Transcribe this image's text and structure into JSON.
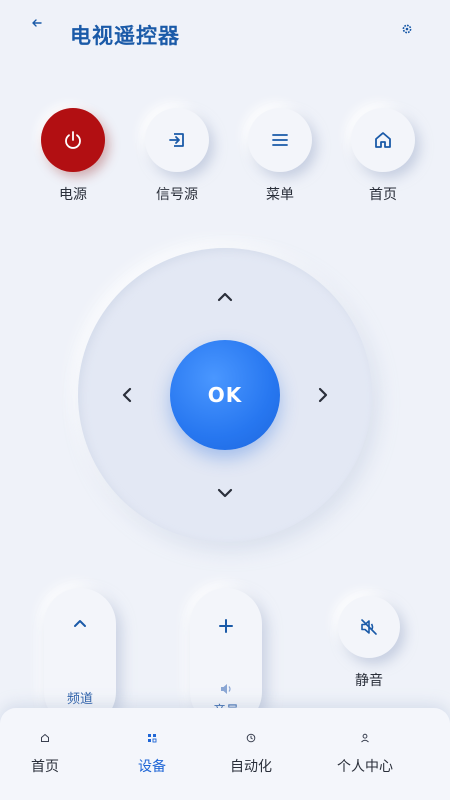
{
  "header": {
    "title": "电视遥控器",
    "back_icon": "back-arrow-icon",
    "settings_icon": "gear-icon"
  },
  "quick_buttons": [
    {
      "label": "电源",
      "icon": "power-icon",
      "color": "#b20f12"
    },
    {
      "label": "信号源",
      "icon": "input-source-icon"
    },
    {
      "label": "菜单",
      "icon": "menu-icon"
    },
    {
      "label": "首页",
      "icon": "home-icon"
    }
  ],
  "dpad": {
    "ok_label": "OK",
    "ok_color": "#2777f0"
  },
  "controls": {
    "channel_label": "频道",
    "volume_label": "音量",
    "mute_label": "静音"
  },
  "bottom_nav": {
    "active": "设备",
    "items": [
      {
        "label": "首页",
        "icon": "home-icon"
      },
      {
        "label": "设备",
        "icon": "devices-icon"
      },
      {
        "label": "自动化",
        "icon": "clock-icon"
      },
      {
        "label": "个人中心",
        "icon": "person-icon"
      }
    ]
  },
  "colors": {
    "accent": "#1f66d6",
    "title": "#1a5aa8",
    "background": "#eff2f9"
  }
}
